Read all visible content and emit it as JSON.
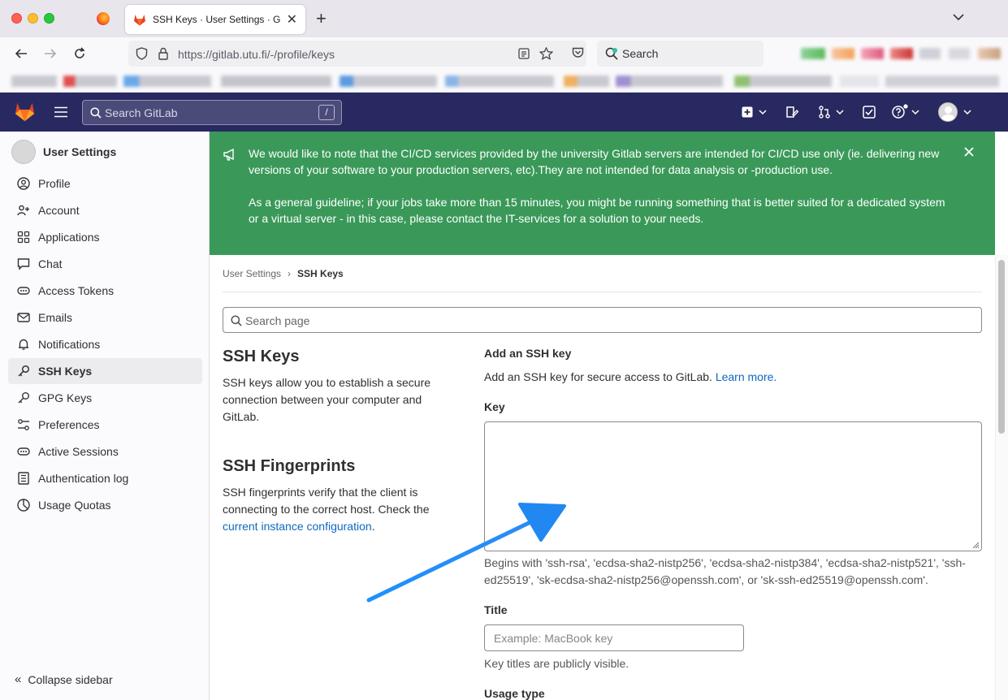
{
  "browser": {
    "tab_title": "SSH Keys · User Settings · GitLab",
    "url": "https://gitlab.utu.fi/-/profile/keys",
    "search_placeholder": "Search"
  },
  "header": {
    "search_placeholder": "Search GitLab",
    "search_shortcut": "/"
  },
  "sidebar": {
    "title": "User Settings",
    "items": [
      {
        "label": "Profile",
        "icon": "profile-icon"
      },
      {
        "label": "Account",
        "icon": "account-icon"
      },
      {
        "label": "Applications",
        "icon": "applications-icon"
      },
      {
        "label": "Chat",
        "icon": "chat-icon"
      },
      {
        "label": "Access Tokens",
        "icon": "token-icon"
      },
      {
        "label": "Emails",
        "icon": "mail-icon"
      },
      {
        "label": "Notifications",
        "icon": "bell-icon"
      },
      {
        "label": "SSH Keys",
        "icon": "key-icon",
        "active": true
      },
      {
        "label": "GPG Keys",
        "icon": "key-icon"
      },
      {
        "label": "Preferences",
        "icon": "preferences-icon"
      },
      {
        "label": "Active Sessions",
        "icon": "sessions-icon"
      },
      {
        "label": "Authentication log",
        "icon": "log-icon"
      },
      {
        "label": "Usage Quotas",
        "icon": "quota-icon"
      }
    ],
    "collapse_label": "Collapse sidebar"
  },
  "banner": {
    "paragraph1": "We would like to note that the CI/CD services provided by the university Gitlab servers are intended for CI/CD use only (ie. delivering new versions of your software to your production servers, etc).They are not intended for data analysis or -production use.",
    "paragraph2": "As a general guideline; if your jobs take more than 15 minutes, you might be running something that is better suited for a dedicated system or a virtual server - in this case, please contact the IT-services for a solution to your needs."
  },
  "breadcrumb": {
    "parent": "User Settings",
    "separator": "›",
    "current": "SSH Keys"
  },
  "page_search_placeholder": "Search page",
  "ssh_keys": {
    "heading": "SSH Keys",
    "description": "SSH keys allow you to establish a secure connection between your computer and GitLab."
  },
  "fingerprints": {
    "heading": "SSH Fingerprints",
    "description": "SSH fingerprints verify that the client is connecting to the correct host. Check the",
    "link": "current instance configuration",
    "suffix": "."
  },
  "add_key": {
    "heading": "Add an SSH key",
    "intro": "Add an SSH key for secure access to GitLab.",
    "learn_more": "Learn more.",
    "key_label": "Key",
    "key_value": "",
    "key_help": "Begins with 'ssh-rsa', 'ecdsa-sha2-nistp256', 'ecdsa-sha2-nistp384', 'ecdsa-sha2-nistp521', 'ssh-ed25519', 'sk-ecdsa-sha2-nistp256@openssh.com', or 'sk-ssh-ed25519@openssh.com'.",
    "title_label": "Title",
    "title_placeholder": "Example: MacBook key",
    "title_help": "Key titles are publicly visible.",
    "usage_label": "Usage type"
  },
  "colors": {
    "header_bg": "#292961",
    "banner_bg": "#3a9959",
    "link": "#1068bf",
    "annotation_arrow": "#1e90ff"
  }
}
